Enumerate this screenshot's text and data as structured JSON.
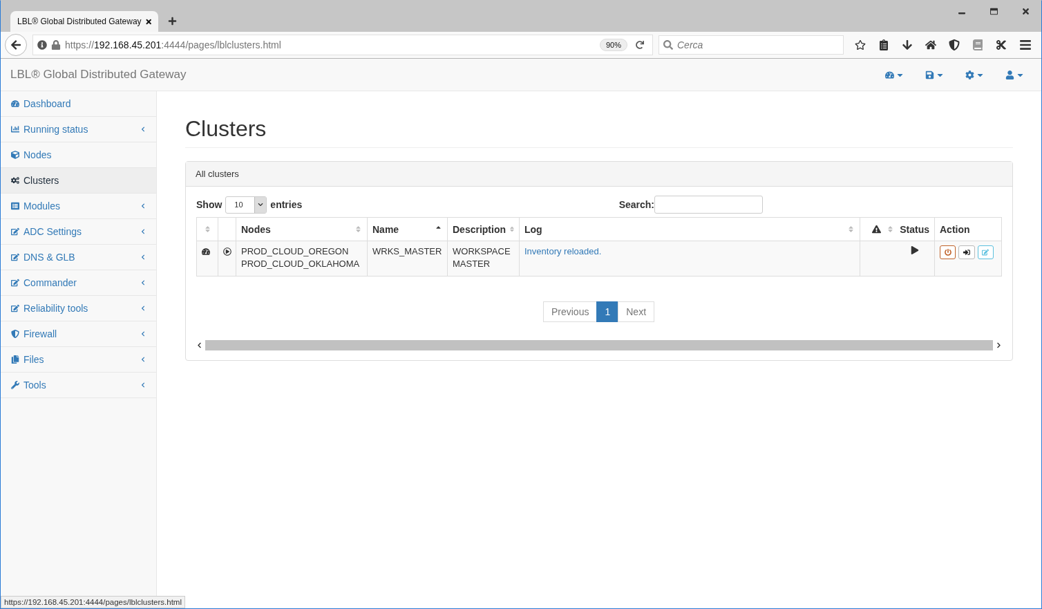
{
  "browser": {
    "tab_title": "LBL® Global Distributed Gateway",
    "url": {
      "scheme": "https://",
      "host": "192.168.45.201",
      "path": ":4444/pages/lblclusters.html"
    },
    "zoom": "90%",
    "search": {
      "placeholder": "Cerca"
    },
    "status_url": "https://192.168.45.201:4444/pages/lblclusters.html"
  },
  "app": {
    "brand": "LBL® Global Distributed Gateway"
  },
  "sidebar": {
    "items": [
      {
        "label": "Dashboard",
        "selected": false,
        "expandable": false
      },
      {
        "label": "Running status",
        "selected": false,
        "expandable": true
      },
      {
        "label": "Nodes",
        "selected": false,
        "expandable": false
      },
      {
        "label": "Clusters",
        "selected": true,
        "expandable": false
      },
      {
        "label": "Modules",
        "selected": false,
        "expandable": true
      },
      {
        "label": "ADC Settings",
        "selected": false,
        "expandable": true
      },
      {
        "label": "DNS & GLB",
        "selected": false,
        "expandable": true
      },
      {
        "label": "Commander",
        "selected": false,
        "expandable": true
      },
      {
        "label": "Reliability tools",
        "selected": false,
        "expandable": true
      },
      {
        "label": "Firewall",
        "selected": false,
        "expandable": true
      },
      {
        "label": "Files",
        "selected": false,
        "expandable": true
      },
      {
        "label": "Tools",
        "selected": false,
        "expandable": true
      }
    ]
  },
  "page": {
    "title": "Clusters",
    "panel_title": "All clusters",
    "length": {
      "label_before": "Show",
      "value": "10",
      "label_after": "entries"
    },
    "search": {
      "label": "Search:"
    },
    "table": {
      "columns": [
        {
          "kind": "blank",
          "sortable": true,
          "sorted": false
        },
        {
          "kind": "blank",
          "sortable": false
        },
        {
          "kind": "text",
          "label": "Nodes",
          "sortable": true,
          "sorted": false
        },
        {
          "kind": "text",
          "label": "Name",
          "sortable": true,
          "sorted": true
        },
        {
          "kind": "text",
          "label": "Description",
          "sortable": true,
          "sorted": false
        },
        {
          "kind": "text",
          "label": "Log",
          "sortable": true,
          "sorted": false
        },
        {
          "kind": "status",
          "label": "Status",
          "sortable": true,
          "sorted": false
        },
        {
          "kind": "text",
          "label": "Action",
          "sortable": false
        }
      ],
      "rows": [
        {
          "nodes": [
            "PROD_CLOUD_OREGON",
            "PROD_CLOUD_OKLAHOMA"
          ],
          "name": "WRKS_MASTER",
          "description": "WORKSPACE MASTER",
          "log": "Inventory reloaded."
        }
      ]
    },
    "pagination": [
      {
        "label": "Previous",
        "selected": false
      },
      {
        "label": "1",
        "selected": true
      },
      {
        "label": "Next",
        "selected": false
      }
    ]
  }
}
